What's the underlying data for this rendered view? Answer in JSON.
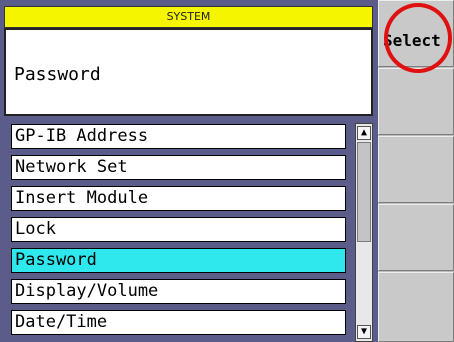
{
  "header": {
    "title": "SYSTEM"
  },
  "value_display": {
    "text": "Password"
  },
  "menu": {
    "items": [
      {
        "label": "GP-IB Address"
      },
      {
        "label": "Network Set"
      },
      {
        "label": "Insert Module"
      },
      {
        "label": "Lock"
      },
      {
        "label": "Password",
        "selected": true
      },
      {
        "label": "Display/Volume"
      },
      {
        "label": "Date/Time"
      }
    ]
  },
  "scrollbar": {
    "up_icon": "triangle-up-icon",
    "down_icon": "triangle-down-icon"
  },
  "softkeys": {
    "select_label": "Select"
  },
  "colors": {
    "header_bg": "#f5f500",
    "selected_bg": "#2ee8ee",
    "highlight_ring": "#e01010",
    "background": "#5c5c8a"
  }
}
